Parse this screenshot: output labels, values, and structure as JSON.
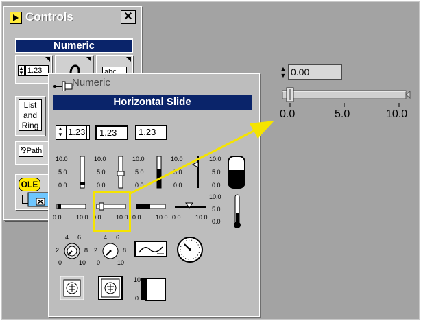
{
  "controls_palette": {
    "title": "Controls",
    "close_label": "✕",
    "category_header": "Numeric",
    "digital_value": "1.23",
    "string_value": "abc",
    "list_ring_label": [
      "List",
      "and",
      "Ring"
    ],
    "path_label": "Path",
    "ole_label": "OLE"
  },
  "numeric_subpalette": {
    "title": "Numeric",
    "header": "Horizontal Slide",
    "digital_controls": [
      "1.23",
      "1.23",
      "1.23"
    ],
    "slide_scale": {
      "top": "10.0",
      "mid": "5.0",
      "bottom": "0.0"
    },
    "hslide_scale": {
      "min": "0.0",
      "max": "10.0"
    },
    "knob_scale": {
      "top_left": "4",
      "top_right": "6",
      "left": "2",
      "right": "8",
      "bottom_left": "0",
      "bottom_right": "10"
    },
    "gauge_scale": {
      "top": "10",
      "bottom": "0"
    }
  },
  "front_panel": {
    "digital_value": "0.00",
    "scale": [
      "0.0",
      "5.0",
      "10.0"
    ],
    "slider_fraction": 0
  },
  "colors": {
    "header_bg": "#0a246a",
    "highlight": "#f5e400",
    "arrow": "#f5e400",
    "stage": "#a3a3a3",
    "palette": "#bdbdbd"
  }
}
